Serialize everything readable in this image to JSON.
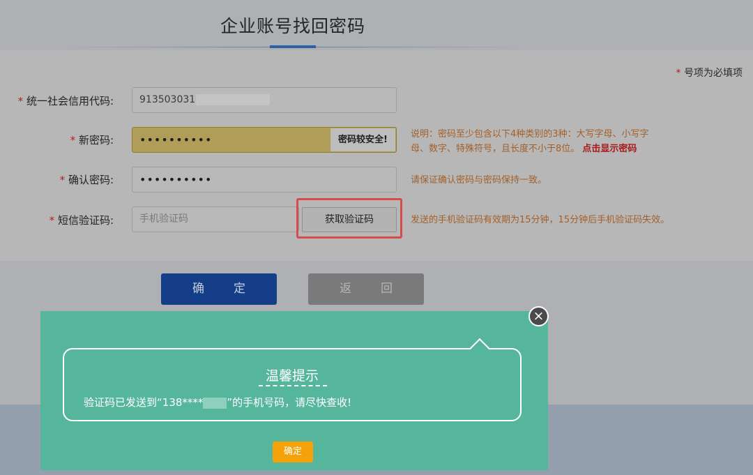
{
  "page": {
    "title": "企业账号找回密码",
    "required_note_star": "*",
    "required_note_text": " 号项为必填项"
  },
  "form": {
    "credit_code": {
      "star": "* ",
      "label": "统一社会信用代码:",
      "value_visible": "913503031"
    },
    "new_password": {
      "star": "* ",
      "label": "新密码:",
      "value": "••••••••••",
      "strength": "密码较安全!",
      "hint_line1": "说明：密码至少包含以下4种类别的3种：大写字母、小写字",
      "hint_line2": "母、数字、特殊符号，且长度不小于8位。",
      "show_password_link": "点击显示密码"
    },
    "confirm_password": {
      "star": "* ",
      "label": "确认密码:",
      "value": "••••••••••",
      "hint": "请保证确认密码与密码保持一致。"
    },
    "sms_code": {
      "star": "* ",
      "label": "短信验证码:",
      "placeholder": "手机验证码",
      "button": "获取验证码",
      "hint": "发送的手机验证码有效期为15分钟，15分钟后手机验证码失效。"
    }
  },
  "actions": {
    "confirm": "确定",
    "back": "返回"
  },
  "popup": {
    "close_icon": "×",
    "title": "温馨提示",
    "message_prefix": "验证码已发送到“138****",
    "message_suffix": "”的手机号码，请尽快查收!",
    "ok_button": "确定"
  },
  "colors": {
    "popup_bg": "#56b69c",
    "ok_button": "#f5a10a",
    "confirm_button": "#143f88",
    "highlight_border": "#d84b4b"
  }
}
